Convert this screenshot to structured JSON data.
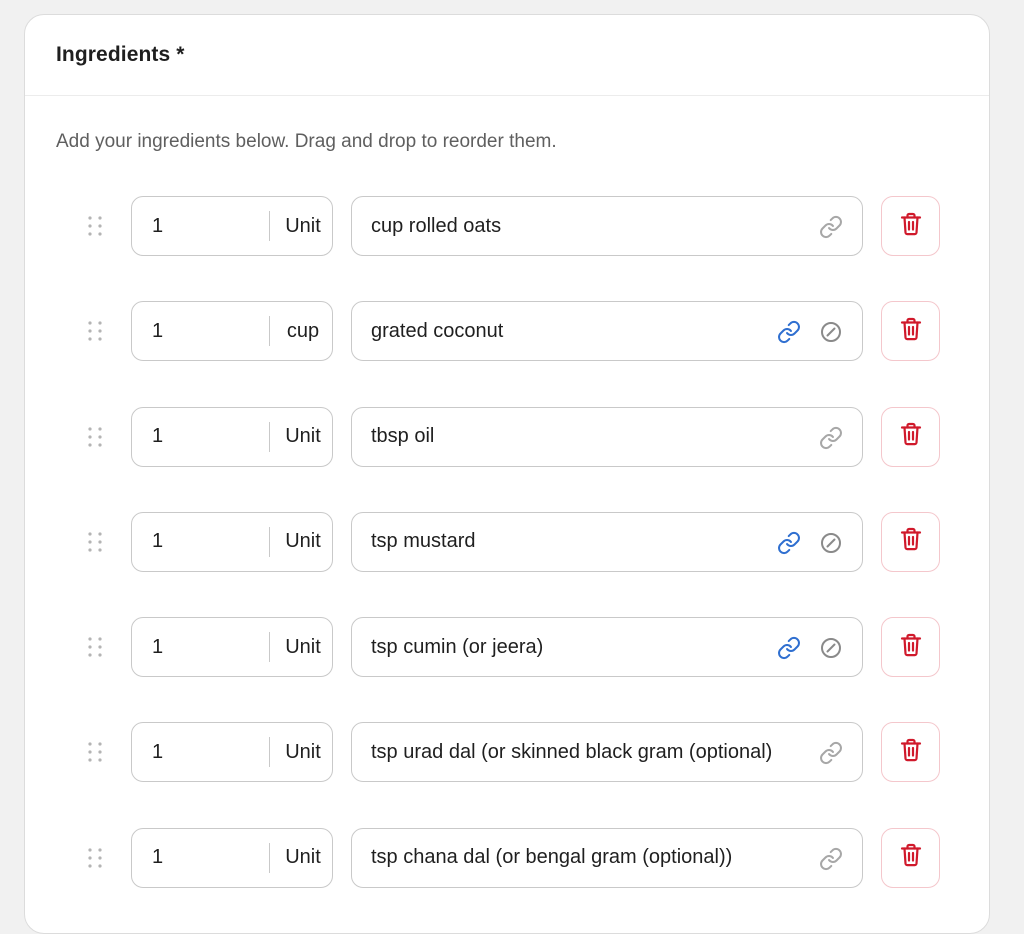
{
  "header": {
    "title": "Ingredients *"
  },
  "hint": "Add your ingredients below. Drag and drop to reorder them.",
  "colors": {
    "link_active": "#2f6fd0",
    "link_idle": "#8a8a8a",
    "delete": "#d0192b"
  },
  "ingredients": [
    {
      "quantity": "1",
      "unit": "Unit",
      "name": "cup rolled oats",
      "linked": false
    },
    {
      "quantity": "1",
      "unit": "cup",
      "name": "grated coconut",
      "linked": true
    },
    {
      "quantity": "1",
      "unit": "Unit",
      "name": "tbsp oil",
      "linked": false
    },
    {
      "quantity": "1",
      "unit": "Unit",
      "name": "tsp mustard",
      "linked": true
    },
    {
      "quantity": "1",
      "unit": "Unit",
      "name": "tsp cumin (or jeera)",
      "linked": true
    },
    {
      "quantity": "1",
      "unit": "Unit",
      "name": "tsp urad dal (or skinned black gram (optional))",
      "linked": false
    },
    {
      "quantity": "1",
      "unit": "Unit",
      "name": "tsp chana dal (or bengal gram (optional))",
      "linked": false
    }
  ]
}
